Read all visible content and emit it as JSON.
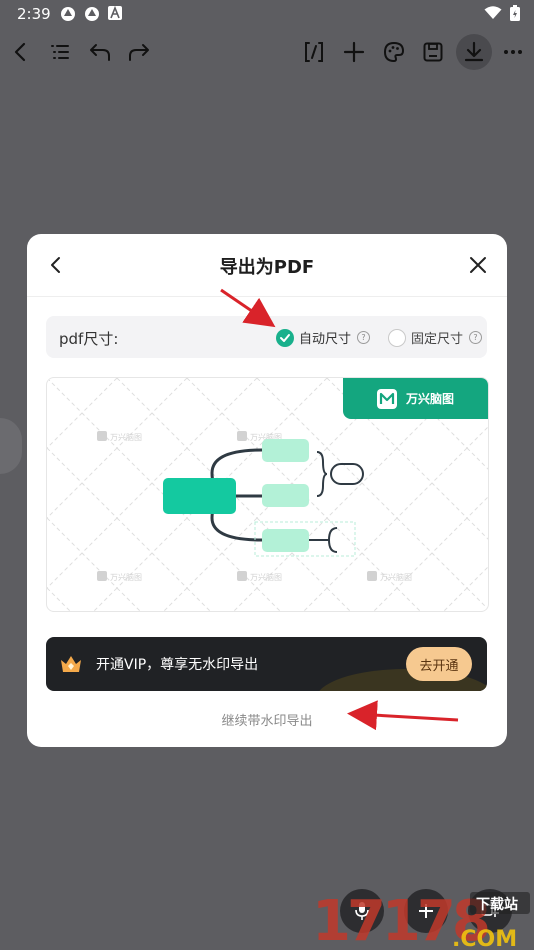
{
  "status": {
    "time": "2:39"
  },
  "toolbar": {
    "icons": [
      "back-icon",
      "outline-icon",
      "undo-icon",
      "redo-icon",
      "ai-brackets-icon",
      "add-icon",
      "palette-icon",
      "save-icon",
      "download-icon",
      "more-icon"
    ]
  },
  "dialog": {
    "title": "导出为PDF",
    "size_label": "pdf尺寸:",
    "option_auto": "自动尺寸",
    "option_fixed": "固定尺寸",
    "selected_option": "自动尺寸",
    "help_glyph": "?",
    "brand_name": "万兴脑图",
    "vip_text": "开通VIP，尊享无水印导出",
    "vip_button": "去开通",
    "continue_label": "继续带水印导出"
  },
  "watermark": {
    "text": "17178.COM",
    "badge": "下载站"
  },
  "colors": {
    "accent": "#19b08c",
    "brand": "#14a67f",
    "vip_bg": "#202225",
    "vip_button": "#f6c990",
    "annotation_arrow": "#d9232a"
  }
}
